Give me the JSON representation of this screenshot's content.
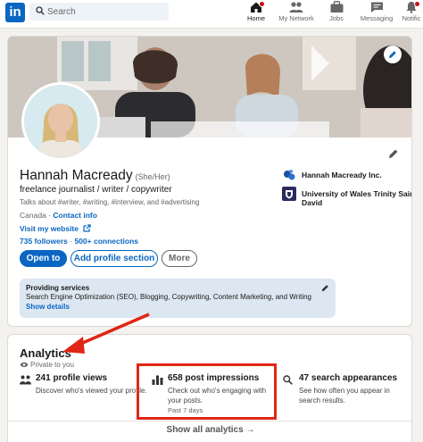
{
  "nav": {
    "search_placeholder": "Search",
    "items": [
      {
        "label": "Home",
        "icon": "home-icon"
      },
      {
        "label": "My Network",
        "icon": "network-icon"
      },
      {
        "label": "Jobs",
        "icon": "briefcase-icon"
      },
      {
        "label": "Messaging",
        "icon": "messaging-icon"
      },
      {
        "label": "Notific",
        "icon": "bell-icon"
      }
    ]
  },
  "profile": {
    "name": "Hannah Macready",
    "pronouns": "(She/Her)",
    "headline": "freelance journalist / writer / copywriter",
    "talks_about": "Talks about #writer, #writing, #interview, and #advertising",
    "location": "Canada",
    "contact_label": "Contact info",
    "website_label": "Visit my website",
    "followers": "735 followers",
    "connections": "500+ connections",
    "separator": "·",
    "buttons": {
      "open_to": "Open to",
      "add_section": "Add profile section",
      "more": "More"
    },
    "orgs": [
      {
        "name": "Hannah Macready Inc."
      },
      {
        "name": "University of Wales Trinity Saint David"
      }
    ],
    "services": {
      "title": "Providing services",
      "list": "Search Engine Optimization (SEO), Blogging, Copywriting, Content Marketing, and Writing",
      "show_details": "Show details"
    }
  },
  "analytics": {
    "title": "Analytics",
    "private": "Private to you",
    "metrics": [
      {
        "title": "241 profile views",
        "desc": "Discover who's viewed your profile.",
        "sub": ""
      },
      {
        "title": "658 post impressions",
        "desc": "Check out who's engaging with your posts.",
        "sub": "Past 7 days"
      },
      {
        "title": "47 search appearances",
        "desc": "See how often you appear in search results.",
        "sub": ""
      }
    ],
    "show_all": "Show all analytics →"
  },
  "colors": {
    "brand": "#0a66c2",
    "highlight": "#e02616",
    "background": "#f3f2ef"
  }
}
